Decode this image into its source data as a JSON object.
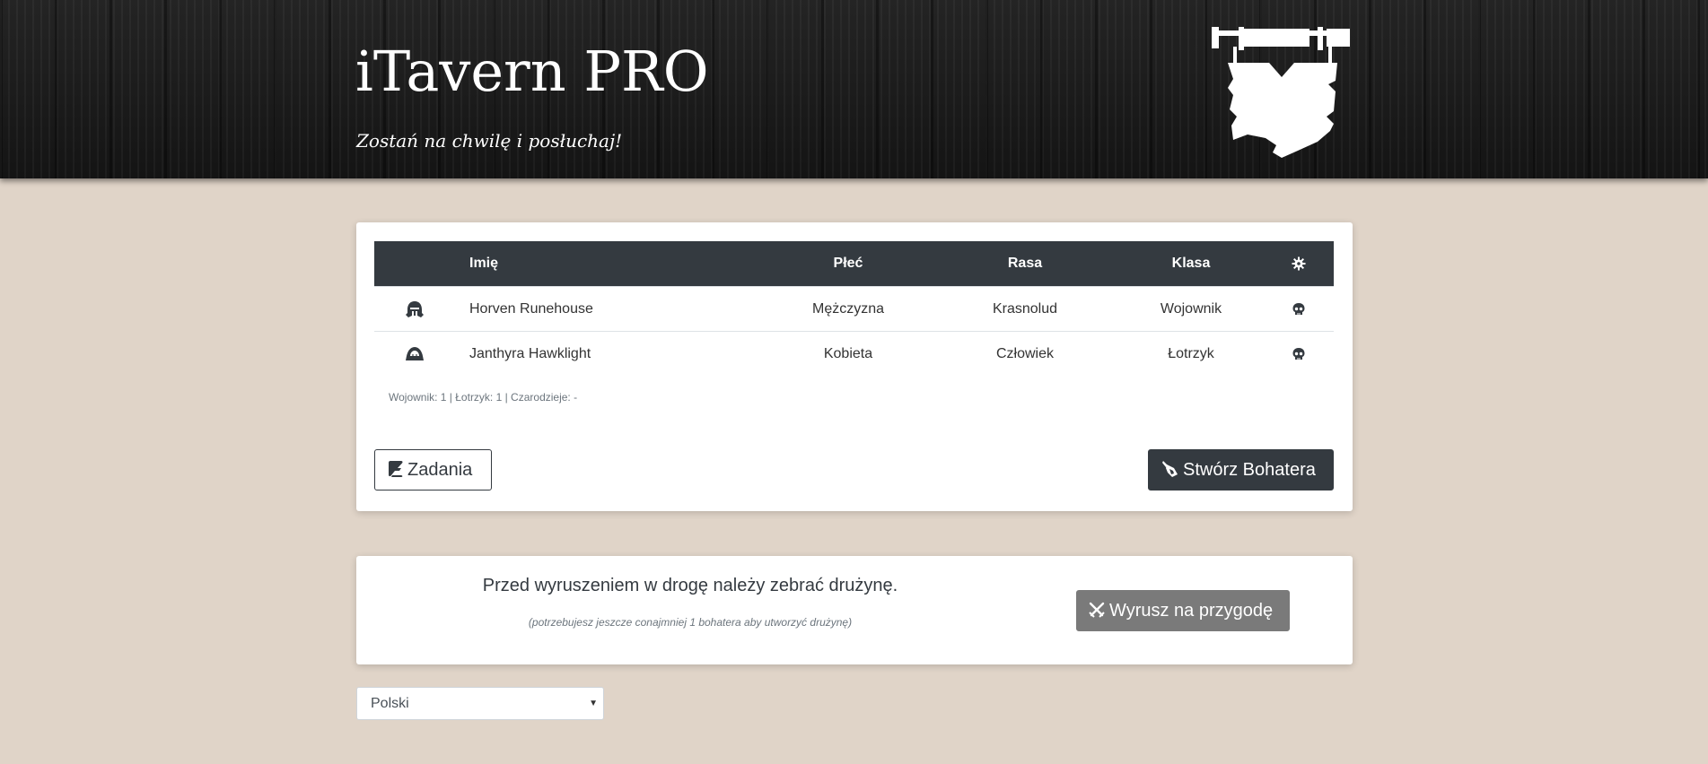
{
  "header": {
    "title": "iTavern PRO",
    "subtitle": "Zostań na chwilę i posłuchaj!",
    "logo_icon": "tavern-sign-icon"
  },
  "heroes_table": {
    "columns": {
      "name": "Imię",
      "sex": "Płeć",
      "race": "Rasa",
      "class": "Klasa",
      "settings_icon": "gear-icon"
    },
    "rows": [
      {
        "avatar_icon": "helmet-icon",
        "name": "Horven Runehouse",
        "sex": "Mężczyzna",
        "race": "Krasnolud",
        "class": "Wojownik",
        "action_icon": "skull-icon"
      },
      {
        "avatar_icon": "hood-icon",
        "name": "Janthyra Hawklight",
        "sex": "Kobieta",
        "race": "Człowiek",
        "class": "Łotrzyk",
        "action_icon": "skull-icon"
      }
    ],
    "class_counts": "Wojownik: 1 | Łotrzyk: 1 | Czarodzieje: -"
  },
  "buttons": {
    "quests": "Zadania",
    "create_hero": "Stwórz Bohatera",
    "adventure": "Wyrusz na przygodę"
  },
  "party": {
    "message": "Przed wyruszeniem w drogę należy zebrać drużynę.",
    "note": "(potrzebujesz jeszcze conajmniej 1 bohatera aby utworzyć drużynę)"
  },
  "language": {
    "selected": "Polski"
  },
  "colors": {
    "background": "#e0d4c8",
    "dark": "#343a40",
    "disabled_button": "#7a7a7a"
  }
}
